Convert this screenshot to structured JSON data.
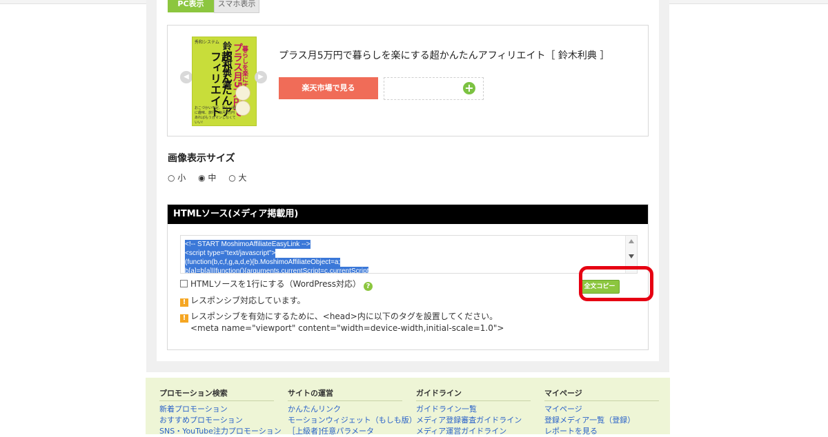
{
  "tabs": {
    "active_label": "PC表示",
    "inactive_label": "スマホ表示"
  },
  "preview": {
    "book_cover": {
      "publisher": "秀和システム",
      "title_pink": "プラス月5万円で",
      "title_line2": "暮らしを楽にする",
      "title_main": "超かんたんアフィリエイト",
      "subtitle": "鈴木利典 著",
      "tagline": "おこづかい不足、新しい服に趣味、旅行…毎月5万円あればもうガマンしなくていい!"
    },
    "book_title": "プラス月5万円で暮らしを楽にする超かんたんアフィリエイト［ 鈴木利典 ］",
    "rakuten_button": "楽天市場で見る",
    "add_icon": "plus-circle-icon"
  },
  "image_size": {
    "heading": "画像表示サイズ",
    "options": [
      "○ 小",
      "◉ 中",
      "○ 大"
    ],
    "selected": "中"
  },
  "html_source": {
    "heading": "HTMLソース(メディア掲載用)",
    "code_lines": [
      "<!-- START MoshimoAffiliateEasyLink -->",
      "<script type=\"text/javascript\">",
      "(function(b,c,f,g,a,d,e){b.MoshimoAffiliateObject=a;",
      "b[a]=b[a]||function(){arguments.currentScript=c.currentScript"
    ],
    "one_line_label": "HTMLソースを1行にする（WordPress対応）",
    "copy_button": "全文コピー",
    "warning1": "レスポンシブ対応しています。",
    "warning2": "レスポンシブを有効にするために、<head>内に以下のタグを設置してください。",
    "meta_tag": "<meta name=\"viewport\" content=\"width=device-width,initial-scale=1.0\">"
  },
  "footer": {
    "columns": [
      {
        "heading": "プロモーション検索",
        "links": [
          "新着プロモーション",
          "おすすめプロモーション",
          "SNS・YouTube注力プロモーション"
        ]
      },
      {
        "heading": "サイトの運営",
        "links": [
          "かんたんリンク",
          "モーションウィジェット（もしも版）",
          "［上級者]任意パラメータ"
        ]
      },
      {
        "heading": "ガイドライン",
        "links": [
          "ガイドライン一覧",
          "メディア登録審査ガイドライン",
          "メディア運営ガイドライン"
        ]
      },
      {
        "heading": "マイページ",
        "links": [
          "マイページ",
          "登録メディア一覧（登録）",
          "レポートを見る"
        ]
      }
    ]
  },
  "colors": {
    "accent_green": "#8cc63f",
    "rakuten_red": "#f06c58",
    "highlight_ring": "#e60012",
    "footer_bg": "#eef5d6"
  }
}
